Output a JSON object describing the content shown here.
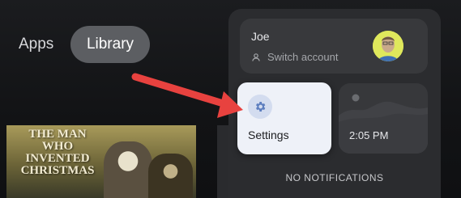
{
  "nav": {
    "apps_label": "Apps",
    "library_label": "Library"
  },
  "poster": {
    "title": "THE MAN WHO INVENTED CHRISTMAS"
  },
  "quick_panel": {
    "account": {
      "name": "Joe",
      "switch_label": "Switch account"
    },
    "settings_label": "Settings",
    "time": "2:05 PM",
    "notifications_label": "NO NOTIFICATIONS"
  },
  "colors": {
    "accent_arrow": "#e8423f",
    "settings_card_bg": "#eef1f8",
    "gear_icon": "#5d7ebf"
  },
  "icons": [
    "switch-account-icon",
    "avatar-image",
    "gear-icon",
    "weather-landscape-icon",
    "arrow-annotation"
  ]
}
